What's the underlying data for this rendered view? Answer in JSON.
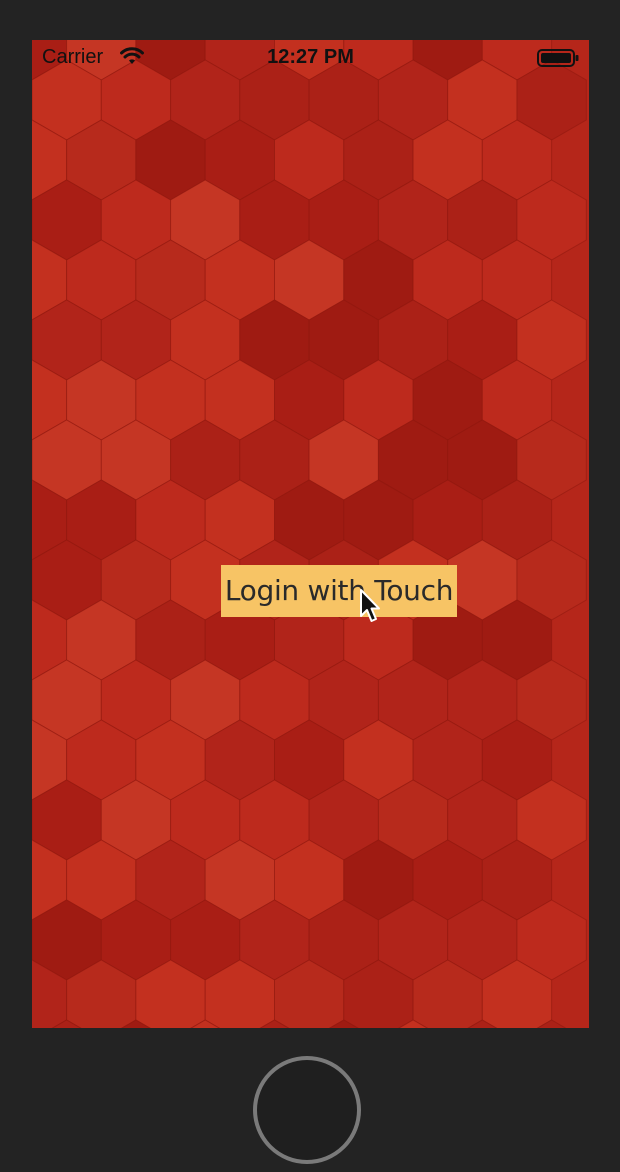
{
  "status_bar": {
    "carrier": "Carrier",
    "time": "12:27 PM",
    "wifi_icon": "wifi-icon",
    "battery_icon": "battery-icon"
  },
  "main": {
    "login_button_label": "Login with Touch",
    "button_color": "#f7c465",
    "background_color": "#b5261a"
  },
  "device": {
    "home_button": "home-button",
    "cursor_icon": "mouse-pointer-icon"
  }
}
